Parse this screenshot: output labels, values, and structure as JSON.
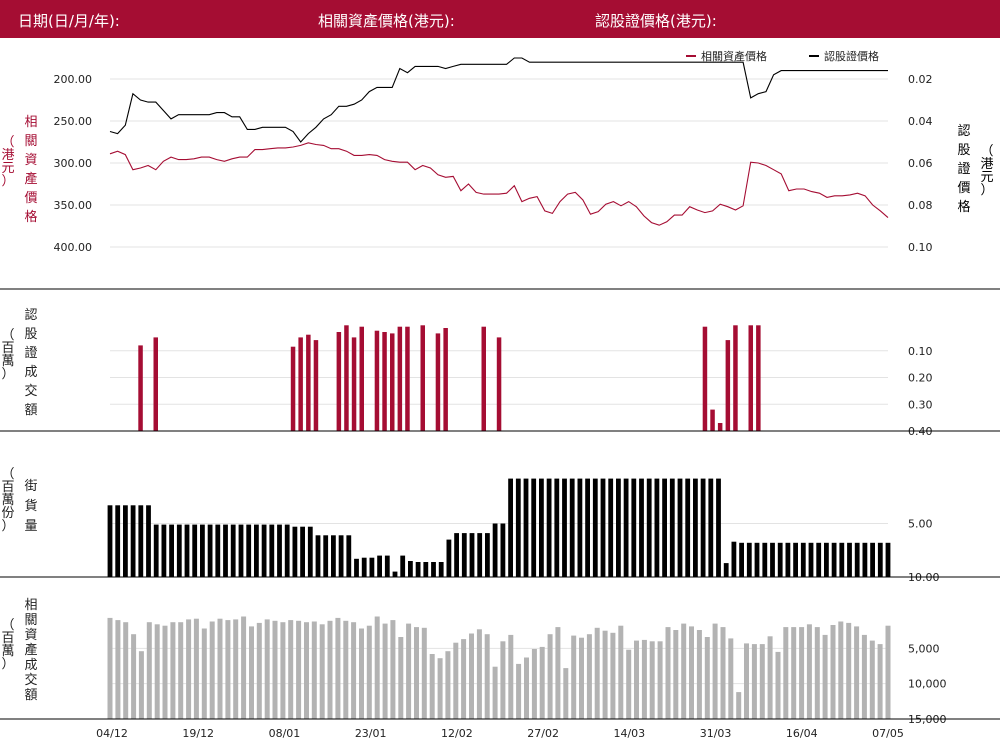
{
  "header": {
    "date_label": "日期(日/月/年):",
    "underlying_label": "相關資產價格(港元):",
    "warrant_label": "認股證價格(港元):"
  },
  "colors": {
    "accent": "#a50d33",
    "black": "#000000",
    "gray_bar": "#b3b3b3",
    "grid": "#e3e3e3"
  },
  "chart_data": [
    {
      "type": "line",
      "legend": [
        "相關資產價格",
        "認股證價格"
      ],
      "legend_position": "top-right",
      "y_left_label": [
        "相",
        "關",
        "資",
        "產",
        "價",
        "格"
      ],
      "y_left_unit": [
        "（",
        "港",
        "元",
        "）"
      ],
      "y_right_label": [
        "認",
        "股",
        "證",
        "價",
        "格"
      ],
      "y_right_unit": [
        "（",
        "港",
        "元",
        "）"
      ],
      "y_left_ticks": [
        "400.00",
        "350.00",
        "300.00",
        "250.00",
        "200.00"
      ],
      "y_left_tick_values": [
        400,
        350,
        300,
        250,
        200
      ],
      "y_left_range": [
        200,
        400
      ],
      "y_right_ticks": [
        "0.10",
        "0.08",
        "0.06",
        "0.04",
        "0.02"
      ],
      "y_right_tick_values": [
        0.1,
        0.08,
        0.06,
        0.04,
        0.02
      ],
      "y_right_range": [
        0.02,
        0.1
      ],
      "series": [
        {
          "name": "相關資產價格",
          "axis": "left",
          "values": [
            289,
            286,
            290,
            308,
            306,
            303,
            308,
            298,
            293,
            296,
            296,
            295,
            293,
            293,
            296,
            298,
            295,
            293,
            293,
            284,
            284,
            283,
            282,
            282,
            281,
            279,
            276,
            278,
            279,
            283,
            283,
            286,
            291,
            291,
            290,
            291,
            296,
            298,
            299,
            299,
            308,
            303,
            306,
            314,
            317,
            316,
            333,
            325,
            335,
            337,
            337,
            337,
            336,
            327,
            346,
            342,
            340,
            357,
            360,
            346,
            337,
            335,
            344,
            361,
            358,
            349,
            346,
            351,
            346,
            352,
            363,
            371,
            374,
            370,
            362,
            362,
            352,
            356,
            359,
            357,
            349,
            352,
            356,
            351,
            299,
            300,
            303,
            308,
            313,
            333,
            331,
            331,
            334,
            336,
            341,
            339,
            339,
            338,
            336,
            339,
            350,
            357,
            365
          ]
        },
        {
          "name": "認股證價格",
          "axis": "right",
          "values": [
            0.045,
            0.046,
            0.042,
            0.027,
            0.03,
            0.031,
            0.031,
            0.035,
            0.039,
            0.037,
            0.037,
            0.037,
            0.037,
            0.037,
            0.036,
            0.036,
            0.038,
            0.038,
            0.044,
            0.044,
            0.043,
            0.043,
            0.043,
            0.043,
            0.045,
            0.05,
            0.046,
            0.043,
            0.039,
            0.037,
            0.033,
            0.033,
            0.032,
            0.03,
            0.026,
            0.024,
            0.024,
            0.024,
            0.015,
            0.017,
            0.014,
            0.014,
            0.014,
            0.014,
            0.015,
            0.014,
            0.013,
            0.013,
            0.013,
            0.013,
            0.013,
            0.013,
            0.013,
            0.01,
            0.01,
            0.012,
            0.012,
            0.012,
            0.012,
            0.012,
            0.012,
            0.012,
            0.012,
            0.012,
            0.012,
            0.012,
            0.012,
            0.012,
            0.012,
            0.012,
            0.012,
            0.012,
            0.012,
            0.012,
            0.012,
            0.012,
            0.012,
            0.012,
            0.012,
            0.012,
            0.012,
            0.012,
            0.012,
            0.012,
            0.029,
            0.027,
            0.026,
            0.018,
            0.016,
            0.016,
            0.016,
            0.016,
            0.016,
            0.016,
            0.016,
            0.016,
            0.016,
            0.016,
            0.016,
            0.016,
            0.016,
            0.016,
            0.016
          ]
        }
      ]
    },
    {
      "type": "bar",
      "y_label": [
        "認",
        "股",
        "證",
        "成",
        "交",
        "額"
      ],
      "y_unit": [
        "（",
        "百",
        "萬",
        "）"
      ],
      "y_ticks": [
        "0.40",
        "0.30",
        "0.20",
        "0.10"
      ],
      "y_tick_values": [
        0.4,
        0.3,
        0.2,
        0.1
      ],
      "y_range": [
        0,
        0.4
      ],
      "series": [
        {
          "name": "認股證成交額",
          "values": [
            0,
            0,
            0,
            0,
            0.08,
            0,
            0.05,
            0,
            0,
            0,
            0,
            0,
            0,
            0,
            0,
            0,
            0,
            0,
            0,
            0,
            0,
            0,
            0,
            0,
            0.085,
            0.05,
            0.04,
            0.06,
            0,
            0,
            0.03,
            0.005,
            0.05,
            0.01,
            0,
            0.025,
            0.03,
            0.035,
            0.01,
            0.01,
            0,
            0.005,
            0,
            0.035,
            0.015,
            0,
            0,
            0,
            0,
            0.01,
            0,
            0.05,
            0,
            0,
            0,
            0,
            0,
            0,
            0,
            0,
            0,
            0,
            0,
            0,
            0,
            0,
            0,
            0,
            0,
            0,
            0,
            0,
            0,
            0,
            0,
            0,
            0,
            0,
            0.01,
            0.32,
            0.37,
            0.06,
            0.005,
            0,
            0.005,
            0.005,
            0,
            0,
            0,
            0,
            0,
            0,
            0,
            0,
            0,
            0,
            0,
            0,
            0,
            0,
            0,
            0,
            0
          ]
        }
      ]
    },
    {
      "type": "bar",
      "y_label": [
        "街",
        "貨",
        "量"
      ],
      "y_unit": [
        "（",
        "百",
        "萬",
        "份",
        "）"
      ],
      "y_ticks": [
        "10.00",
        "5.00"
      ],
      "y_tick_values": [
        10,
        5
      ],
      "y_range": [
        0,
        10
      ],
      "series": [
        {
          "name": "街貨量",
          "values": [
            3.3,
            3.3,
            3.3,
            3.3,
            3.3,
            3.3,
            5.1,
            5.1,
            5.1,
            5.1,
            5.1,
            5.1,
            5.1,
            5.1,
            5.1,
            5.1,
            5.1,
            5.1,
            5.1,
            5.1,
            5.1,
            5.1,
            5.1,
            5.1,
            5.3,
            5.3,
            5.3,
            6.1,
            6.1,
            6.1,
            6.1,
            6.1,
            8.3,
            8.2,
            8.2,
            8.0,
            8.0,
            9.5,
            8.0,
            8.5,
            8.6,
            8.6,
            8.6,
            8.6,
            6.5,
            5.9,
            5.9,
            5.9,
            5.9,
            5.9,
            5.0,
            5.0,
            0.8,
            0.8,
            0.8,
            0.8,
            0.8,
            0.8,
            0.8,
            0.8,
            0.8,
            0.8,
            0.8,
            0.8,
            0.8,
            0.8,
            0.8,
            0.8,
            0.8,
            0.8,
            0.8,
            0.8,
            0.8,
            0.8,
            0.8,
            0.8,
            0.8,
            0.8,
            0.8,
            0.8,
            8.7,
            6.7,
            6.8,
            6.8,
            6.8,
            6.8,
            6.8,
            6.8,
            6.8,
            6.8,
            6.8,
            6.8,
            6.8,
            6.8,
            6.8,
            6.8,
            6.8,
            6.8,
            6.8,
            6.8,
            6.8,
            6.8
          ]
        }
      ]
    },
    {
      "type": "bar",
      "y_label": [
        "相",
        "關",
        "資",
        "產",
        "成",
        "交",
        "額"
      ],
      "y_unit": [
        "（",
        "百",
        "萬",
        "）"
      ],
      "y_ticks": [
        "15,000",
        "10,000",
        "5,000"
      ],
      "y_tick_values": [
        15000,
        10000,
        5000
      ],
      "y_range": [
        0,
        15000
      ],
      "x_ticks": [
        "04/12",
        "19/12",
        "08/01",
        "23/01",
        "12/02",
        "27/02",
        "14/03",
        "31/03",
        "16/04",
        "07/05"
      ],
      "series": [
        {
          "name": "相關資產成交額",
          "values": [
            700,
            1000,
            1300,
            3000,
            5400,
            1300,
            1600,
            1800,
            1300,
            1300,
            900,
            800,
            2200,
            1200,
            800,
            1000,
            900,
            500,
            1900,
            1400,
            900,
            1100,
            1300,
            1000,
            1100,
            1300,
            1200,
            1600,
            1100,
            700,
            1100,
            1300,
            2200,
            1800,
            500,
            1500,
            1000,
            3400,
            1500,
            2000,
            2100,
            5800,
            6400,
            5400,
            4200,
            3700,
            2900,
            2300,
            3000,
            7600,
            4000,
            3100,
            7200,
            6300,
            5100,
            4800,
            3000,
            2000,
            7800,
            3200,
            3500,
            3000,
            2100,
            2500,
            2800,
            1800,
            5200,
            3900,
            3800,
            4000,
            4000,
            2000,
            2400,
            1500,
            1900,
            2400,
            3400,
            1500,
            2000,
            3600,
            11200,
            4300,
            4400,
            4400,
            3300,
            5500,
            2000,
            2000,
            2000,
            1600,
            2000,
            3100,
            1700,
            1200,
            1400,
            1900,
            3100,
            3900,
            4400,
            1800
          ]
        }
      ]
    }
  ]
}
